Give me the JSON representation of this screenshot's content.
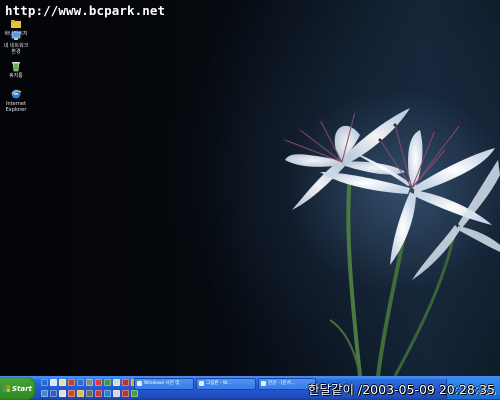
{
  "watermark": {
    "text": "http://www.bcpark.net"
  },
  "desktop": {
    "icons": [
      {
        "label": "바나페이지",
        "icon": "folder-icon"
      },
      {
        "label": "내 네트워크 환경",
        "icon": "network-places-icon"
      },
      {
        "label": "휴지통",
        "icon": "recycle-bin-icon"
      },
      {
        "label": "Internet Explorer",
        "icon": "internet-explorer-icon"
      }
    ]
  },
  "taskbar": {
    "start_label": "Start",
    "quick_launch_colors": [
      "#2a6cd6",
      "#d8e6f8",
      "#e8e0a0",
      "#c04030",
      "#3070c8",
      "#8a8a8a",
      "#d84040",
      "#3a9a3a",
      "#d8d8d8",
      "#c03030",
      "#e8a020",
      "#3a8ad8",
      "#2a60c0",
      "#e0e0e0",
      "#d04a2a",
      "#e0c040",
      "#6a6a6a",
      "#c83838",
      "#3080d0",
      "#d8d8d8",
      "#b03a3a",
      "#4aa040"
    ],
    "tasks": [
      {
        "label": "Windows 사진 및",
        "icon": "window-icon"
      },
      {
        "label": "그림판 - W...",
        "icon": "paint-icon"
      },
      {
        "label": "한글 - [문서...",
        "icon": "document-icon"
      }
    ],
    "tray_time": "오후 8:28"
  },
  "clock_overlay": "한달같이 /2003-05-09 20:28:35",
  "colors": {
    "taskbar": "#245edb",
    "start": "#3a9a2f",
    "text": "#ffffff"
  }
}
